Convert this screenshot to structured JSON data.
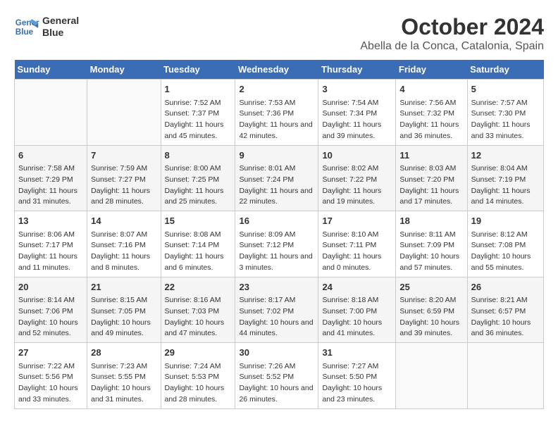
{
  "header": {
    "logo_line1": "General",
    "logo_line2": "Blue",
    "title": "October 2024",
    "subtitle": "Abella de la Conca, Catalonia, Spain"
  },
  "days_of_week": [
    "Sunday",
    "Monday",
    "Tuesday",
    "Wednesday",
    "Thursday",
    "Friday",
    "Saturday"
  ],
  "weeks": [
    [
      {
        "day": "",
        "info": ""
      },
      {
        "day": "",
        "info": ""
      },
      {
        "day": "1",
        "info": "Sunrise: 7:52 AM\nSunset: 7:37 PM\nDaylight: 11 hours and 45 minutes."
      },
      {
        "day": "2",
        "info": "Sunrise: 7:53 AM\nSunset: 7:36 PM\nDaylight: 11 hours and 42 minutes."
      },
      {
        "day": "3",
        "info": "Sunrise: 7:54 AM\nSunset: 7:34 PM\nDaylight: 11 hours and 39 minutes."
      },
      {
        "day": "4",
        "info": "Sunrise: 7:56 AM\nSunset: 7:32 PM\nDaylight: 11 hours and 36 minutes."
      },
      {
        "day": "5",
        "info": "Sunrise: 7:57 AM\nSunset: 7:30 PM\nDaylight: 11 hours and 33 minutes."
      }
    ],
    [
      {
        "day": "6",
        "info": "Sunrise: 7:58 AM\nSunset: 7:29 PM\nDaylight: 11 hours and 31 minutes."
      },
      {
        "day": "7",
        "info": "Sunrise: 7:59 AM\nSunset: 7:27 PM\nDaylight: 11 hours and 28 minutes."
      },
      {
        "day": "8",
        "info": "Sunrise: 8:00 AM\nSunset: 7:25 PM\nDaylight: 11 hours and 25 minutes."
      },
      {
        "day": "9",
        "info": "Sunrise: 8:01 AM\nSunset: 7:24 PM\nDaylight: 11 hours and 22 minutes."
      },
      {
        "day": "10",
        "info": "Sunrise: 8:02 AM\nSunset: 7:22 PM\nDaylight: 11 hours and 19 minutes."
      },
      {
        "day": "11",
        "info": "Sunrise: 8:03 AM\nSunset: 7:20 PM\nDaylight: 11 hours and 17 minutes."
      },
      {
        "day": "12",
        "info": "Sunrise: 8:04 AM\nSunset: 7:19 PM\nDaylight: 11 hours and 14 minutes."
      }
    ],
    [
      {
        "day": "13",
        "info": "Sunrise: 8:06 AM\nSunset: 7:17 PM\nDaylight: 11 hours and 11 minutes."
      },
      {
        "day": "14",
        "info": "Sunrise: 8:07 AM\nSunset: 7:16 PM\nDaylight: 11 hours and 8 minutes."
      },
      {
        "day": "15",
        "info": "Sunrise: 8:08 AM\nSunset: 7:14 PM\nDaylight: 11 hours and 6 minutes."
      },
      {
        "day": "16",
        "info": "Sunrise: 8:09 AM\nSunset: 7:12 PM\nDaylight: 11 hours and 3 minutes."
      },
      {
        "day": "17",
        "info": "Sunrise: 8:10 AM\nSunset: 7:11 PM\nDaylight: 11 hours and 0 minutes."
      },
      {
        "day": "18",
        "info": "Sunrise: 8:11 AM\nSunset: 7:09 PM\nDaylight: 10 hours and 57 minutes."
      },
      {
        "day": "19",
        "info": "Sunrise: 8:12 AM\nSunset: 7:08 PM\nDaylight: 10 hours and 55 minutes."
      }
    ],
    [
      {
        "day": "20",
        "info": "Sunrise: 8:14 AM\nSunset: 7:06 PM\nDaylight: 10 hours and 52 minutes."
      },
      {
        "day": "21",
        "info": "Sunrise: 8:15 AM\nSunset: 7:05 PM\nDaylight: 10 hours and 49 minutes."
      },
      {
        "day": "22",
        "info": "Sunrise: 8:16 AM\nSunset: 7:03 PM\nDaylight: 10 hours and 47 minutes."
      },
      {
        "day": "23",
        "info": "Sunrise: 8:17 AM\nSunset: 7:02 PM\nDaylight: 10 hours and 44 minutes."
      },
      {
        "day": "24",
        "info": "Sunrise: 8:18 AM\nSunset: 7:00 PM\nDaylight: 10 hours and 41 minutes."
      },
      {
        "day": "25",
        "info": "Sunrise: 8:20 AM\nSunset: 6:59 PM\nDaylight: 10 hours and 39 minutes."
      },
      {
        "day": "26",
        "info": "Sunrise: 8:21 AM\nSunset: 6:57 PM\nDaylight: 10 hours and 36 minutes."
      }
    ],
    [
      {
        "day": "27",
        "info": "Sunrise: 7:22 AM\nSunset: 5:56 PM\nDaylight: 10 hours and 33 minutes."
      },
      {
        "day": "28",
        "info": "Sunrise: 7:23 AM\nSunset: 5:55 PM\nDaylight: 10 hours and 31 minutes."
      },
      {
        "day": "29",
        "info": "Sunrise: 7:24 AM\nSunset: 5:53 PM\nDaylight: 10 hours and 28 minutes."
      },
      {
        "day": "30",
        "info": "Sunrise: 7:26 AM\nSunset: 5:52 PM\nDaylight: 10 hours and 26 minutes."
      },
      {
        "day": "31",
        "info": "Sunrise: 7:27 AM\nSunset: 5:50 PM\nDaylight: 10 hours and 23 minutes."
      },
      {
        "day": "",
        "info": ""
      },
      {
        "day": "",
        "info": ""
      }
    ]
  ]
}
